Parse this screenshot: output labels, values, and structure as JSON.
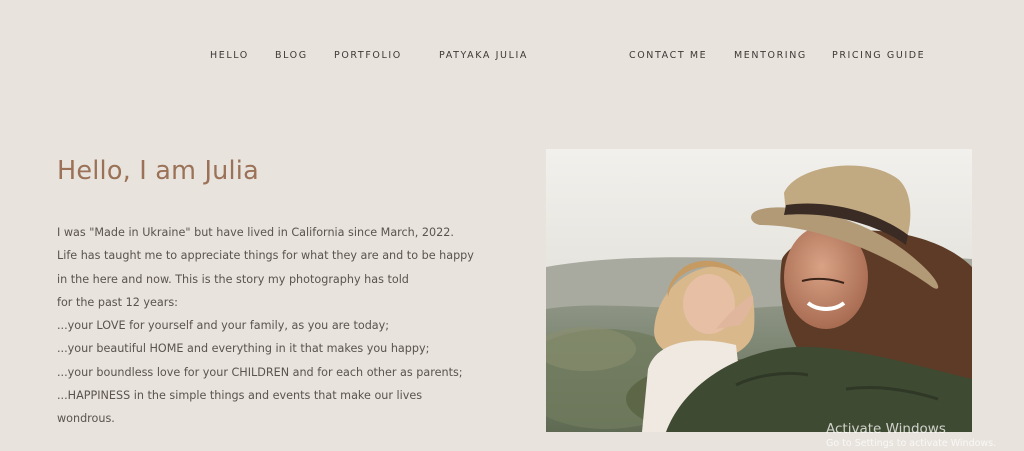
{
  "nav": {
    "left": [
      "HELLO",
      "BLOG",
      "PORTFOLIO"
    ],
    "brand": "PATYAKA JULIA",
    "right": [
      "CONTACT ME",
      "MENTORING",
      "PRICING GUIDE"
    ]
  },
  "intro": {
    "heading": "Hello, I am Julia",
    "lines": [
      "I was \"Made in Ukraine\" but have lived in California since March, 2022.",
      "Life has taught me to appreciate things for what they are and to be happy",
      "in the here and now. This is the story my photography has told",
      "for the past 12 years:",
      "...your LOVE for yourself and your family, as you are today;",
      "...your beautiful HOME and everything in it that makes you happy;",
      "...your boundless love for your CHILDREN and for each other as parents;",
      "...HAPPINESS in the simple things and events that make our lives",
      "wondrous."
    ]
  },
  "watermark": {
    "title": "Activate Windows",
    "subtitle": "Go to Settings to activate Windows."
  },
  "colors": {
    "background": "#e8e3dd",
    "heading": "#9b7257",
    "text": "#5a534e"
  }
}
